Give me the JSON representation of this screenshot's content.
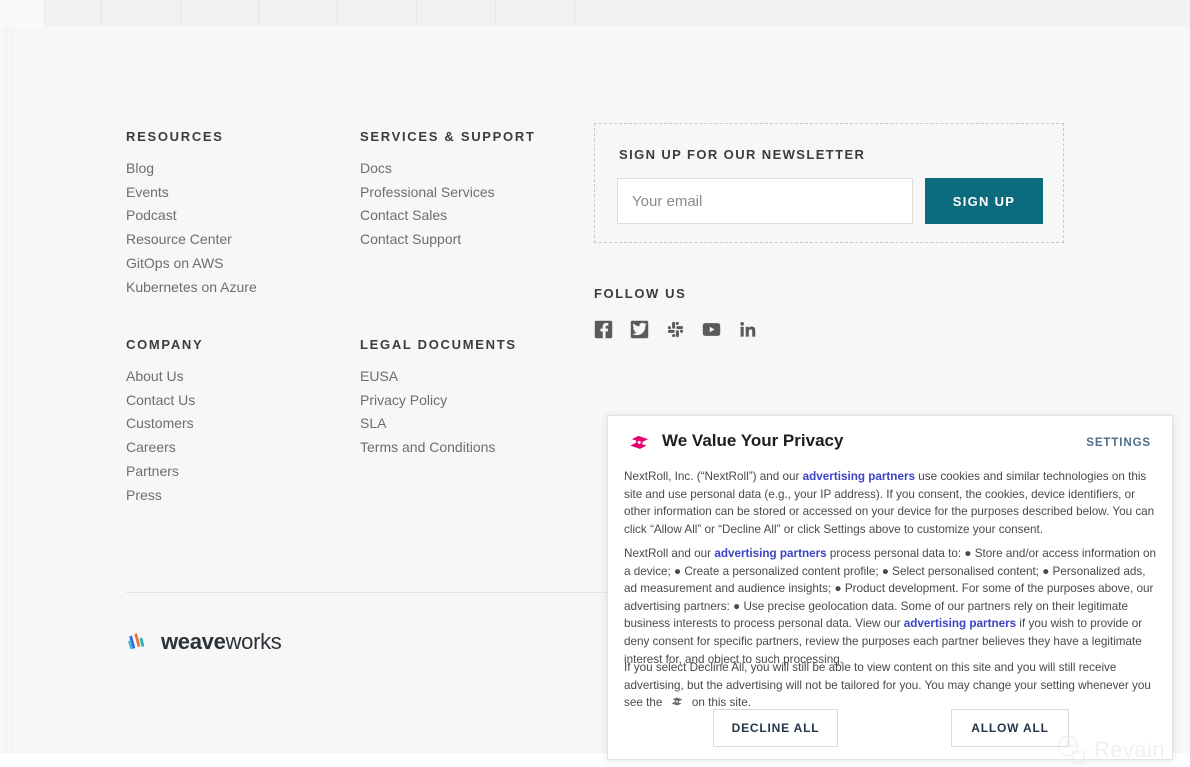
{
  "footer": {
    "columns": [
      {
        "id": "resources",
        "heading": "RESOURCES",
        "links": [
          "Blog",
          "Events",
          "Podcast",
          "Resource Center",
          "GitOps on AWS",
          "Kubernetes on Azure"
        ]
      },
      {
        "id": "services",
        "heading": "SERVICES & SUPPORT",
        "links": [
          "Docs",
          "Professional Services",
          "Contact Sales",
          "Contact Support"
        ]
      },
      {
        "id": "company",
        "heading": "COMPANY",
        "links": [
          "About Us",
          "Contact Us",
          "Customers",
          "Careers",
          "Partners",
          "Press"
        ]
      },
      {
        "id": "legal",
        "heading": "LEGAL DOCUMENTS",
        "links": [
          "EUSA",
          "Privacy Policy",
          "SLA",
          "Terms and Conditions"
        ]
      }
    ],
    "newsletter": {
      "heading": "SIGN UP FOR OUR NEWSLETTER",
      "email_placeholder": "Your email",
      "email_value": "",
      "submit_label": "SIGN UP",
      "submit_color": "#0d6b7e"
    },
    "follow": {
      "heading": "FOLLOW US",
      "icons": [
        {
          "name": "facebook-icon",
          "label": "Facebook"
        },
        {
          "name": "twitter-icon",
          "label": "Twitter"
        },
        {
          "name": "slack-icon",
          "label": "Slack"
        },
        {
          "name": "youtube-icon",
          "label": "YouTube"
        },
        {
          "name": "linkedin-icon",
          "label": "LinkedIn"
        }
      ],
      "icon_color": "#5a5a5a"
    },
    "brand": {
      "name_bold": "weave",
      "name_light": "works"
    }
  },
  "cookie_banner": {
    "title": "We Value Your Privacy",
    "settings_label": "SETTINGS",
    "settings_color": "#4d6e8c",
    "logo_color": "#e6006e",
    "link_color": "#3b44c4",
    "paragraph_1": {
      "part_a": "NextRoll, Inc. (“NextRoll”) and our ",
      "link": "advertising partners",
      "part_b": " use cookies and similar technologies on this site and use personal data (e.g., your IP address). If you consent, the cookies, device identifiers, or other information can be stored or accessed on your device for the purposes described below. You can click “Allow All” or “Decline All” or click Settings above to customize your consent."
    },
    "paragraph_2": {
      "part_a": "NextRoll and our ",
      "link_1": "advertising partners",
      "part_b": " process personal data to: ● Store and/or access information on a device; ● Create a personalized content profile; ● Select personalised content; ● Personalized ads, ad measurement and audience insights; ● Product development. For some of the purposes above, our advertising partners: ● Use precise geolocation data. Some of our partners rely on their legitimate business interests to process personal data. View our ",
      "link_2": "advertising partners",
      "part_c": " if you wish to provide or deny consent for specific partners, review the purposes each partner believes they have a legitimate interest for, and object to such processing."
    },
    "paragraph_3": {
      "part_a": "If you select Decline All, you will still be able to view content on this site and you will still receive advertising, but the advertising will not be tailored for you. You may change your setting whenever you see the ",
      "part_b": " on this site."
    },
    "decline_label": "DECLINE ALL",
    "allow_label": "ALLOW ALL"
  },
  "watermark": {
    "text": "Revain"
  }
}
